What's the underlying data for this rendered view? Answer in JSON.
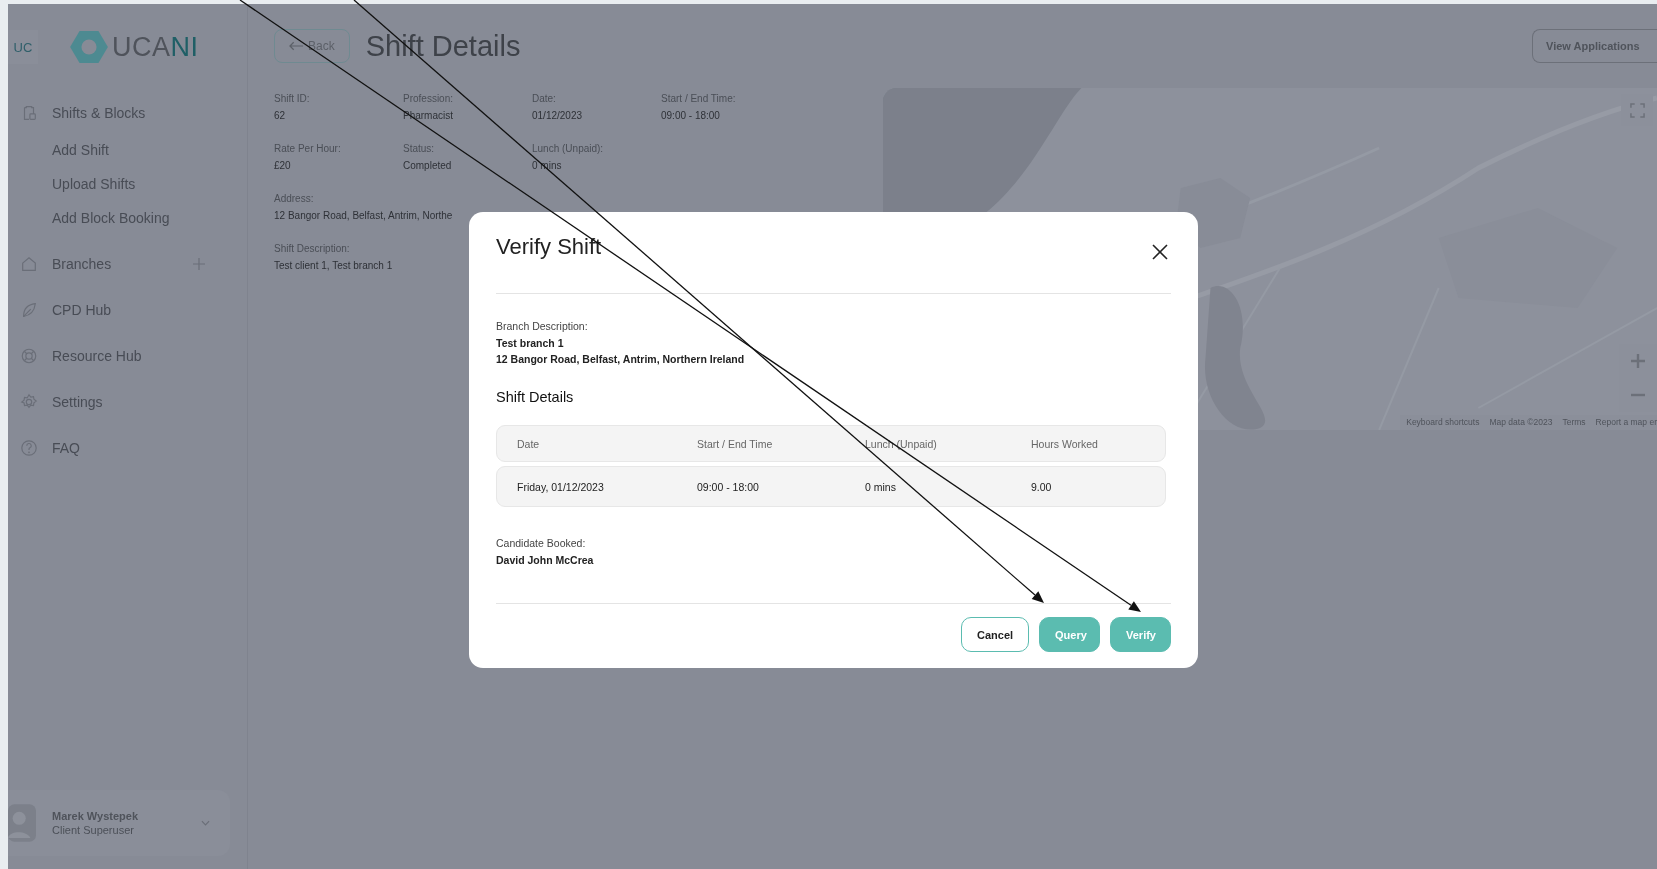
{
  "sidebar": {
    "avatar": "UC",
    "logo": [
      "UCA",
      "NI"
    ],
    "items": [
      {
        "label": "Shifts & Blocks",
        "kind": "clipboard",
        "children": [
          {
            "label": "Add Shift"
          },
          {
            "label": "Upload Shifts"
          },
          {
            "label": "Add Block Booking"
          }
        ]
      },
      {
        "label": "Branches",
        "kind": "house",
        "add": true
      },
      {
        "label": "CPD Hub",
        "kind": "leaf"
      },
      {
        "label": "Resource Hub",
        "kind": "lifebuoy"
      },
      {
        "label": "Settings",
        "kind": "gear"
      },
      {
        "label": "FAQ",
        "kind": "question"
      }
    ],
    "user": {
      "name": "Marek Wystepek",
      "role": "Client Superuser"
    }
  },
  "header": {
    "back": "Back",
    "title": "Shift Details",
    "action": "View Applications"
  },
  "details": [
    [
      {
        "label": "Shift ID:",
        "value": "62"
      },
      {
        "label": "Profession:",
        "value": "Pharmacist"
      },
      {
        "label": "Date:",
        "value": "01/12/2023"
      },
      {
        "label": "Start / End Time:",
        "value": "09:00 - 18:00"
      }
    ],
    [
      {
        "label": "Rate Per Hour:",
        "value": "£20"
      },
      {
        "label": "Status:",
        "value": "Completed"
      },
      {
        "label": "Lunch (Unpaid):",
        "value": "0 mins"
      }
    ],
    [
      {
        "label": "Address:",
        "value": "12 Bangor Road, Belfast, Antrim, Northe"
      }
    ],
    [
      {
        "label": "Shift Description:",
        "value": "Test client 1, Test branch 1"
      }
    ]
  ],
  "map": {
    "kind": "picture",
    "footer": [
      "Keyboard shortcuts",
      "Map data ©2023",
      "Terms",
      "Report a map er"
    ]
  },
  "modal": {
    "title": "Verify Shift",
    "branch_label": "Branch Description:",
    "branch_lines": [
      "Test branch 1",
      "12 Bangor Road, Belfast, Antrim, Northern Ireland"
    ],
    "section": "Shift Details",
    "columns": [
      "Date",
      "Start / End Time",
      "Lunch (Unpaid)",
      "Hours Worked"
    ],
    "rows": [
      [
        "Friday, 01/12/2023",
        "09:00 - 18:00",
        "0 mins",
        "9.00"
      ]
    ],
    "candidate_label": "Candidate Booked:",
    "candidate": "David John McCrea",
    "buttons": [
      {
        "label": "Cancel",
        "kind": "outline"
      },
      {
        "label": "Query",
        "kind": "primary"
      },
      {
        "label": "Verify",
        "kind": "primary"
      }
    ]
  }
}
